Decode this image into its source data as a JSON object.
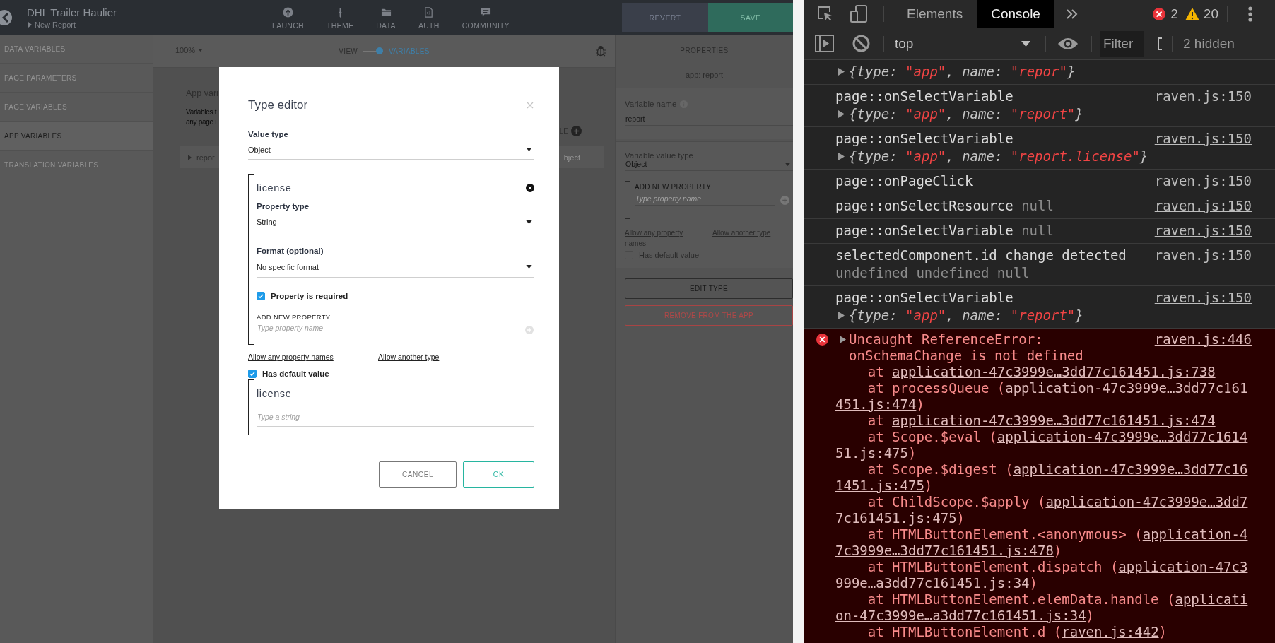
{
  "app": {
    "header": {
      "title": "DHL Trailer Haulier",
      "subtitle": "New Report",
      "nav": [
        "LAUNCH",
        "THEME",
        "DATA",
        "AUTH",
        "COMMUNITY"
      ],
      "buttons": [
        {
          "label": "REVERT",
          "kind": "revert"
        },
        {
          "label": "SAVE",
          "kind": "save"
        }
      ]
    },
    "sidebar": {
      "items": [
        {
          "label": "DATA VARIABLES",
          "selected": false
        },
        {
          "label": "PAGE PARAMETERS",
          "selected": false
        },
        {
          "label": "PAGE VARIABLES",
          "selected": false
        },
        {
          "label": "APP VARIABLES",
          "selected": true
        },
        {
          "label": "TRANSLATION VARIABLES",
          "selected": false
        }
      ]
    },
    "toolbar": {
      "zoom": "100%",
      "view_toggle": {
        "left_label": "VIEW",
        "right_label": "VARIABLES",
        "on": true
      }
    },
    "content": {
      "heading": "App vari",
      "description": [
        "Variables t",
        "any page i"
      ],
      "add_label": "LE",
      "row": {
        "name": "repor",
        "type": "bject"
      }
    },
    "properties": {
      "title": "PROPERTIES",
      "subtitle": "app: report",
      "name_field": {
        "label": "Variable name",
        "value": "report"
      },
      "type_field": {
        "label": "Variable value type",
        "value": "Object"
      },
      "add_property": {
        "label": "ADD NEW PROPERTY",
        "placeholder": "Type property name"
      },
      "links": [
        "Allow any property names",
        "Allow another type"
      ],
      "has_default": {
        "label": "Has default value",
        "checked": false
      },
      "buttons": [
        {
          "label": "EDIT TYPE",
          "kind": "neutral"
        },
        {
          "label": "REMOVE FROM THE APP",
          "kind": "danger"
        }
      ]
    },
    "modal": {
      "title": "Type editor",
      "value_type": {
        "label": "Value type",
        "value": "Object"
      },
      "property": {
        "name": "license",
        "type": {
          "label": "Property type",
          "value": "String"
        },
        "format": {
          "label": "Format (optional)",
          "value": "No specific format"
        },
        "required": {
          "label": "Property is required",
          "checked": true
        }
      },
      "add_property": {
        "label": "ADD NEW PROPERTY",
        "placeholder": "Type property name"
      },
      "links": [
        "Allow any property names",
        "Allow another type"
      ],
      "has_default": {
        "label": "Has default value",
        "checked": true
      },
      "default_value": {
        "name": "license",
        "placeholder": "Type a string"
      },
      "buttons": [
        {
          "label": "CANCEL",
          "kind": "secondary"
        },
        {
          "label": "OK",
          "kind": "primary"
        }
      ]
    }
  },
  "devtools": {
    "tabs": [
      {
        "label": "Elements",
        "selected": false
      },
      {
        "label": "Console",
        "selected": true
      }
    ],
    "error_count": "2",
    "warning_count": "20",
    "context": "top",
    "filter_placeholder": "Filter",
    "hidden_count": "2 hidden",
    "messages": [
      {
        "kind": "object",
        "object": [
          {
            "t": "{type: ",
            "kind": "plain"
          },
          {
            "t": "\"app\"",
            "kind": "string"
          },
          {
            "t": ", name: ",
            "kind": "plain"
          },
          {
            "t": "\"repor\"",
            "kind": "string"
          },
          {
            "t": "}",
            "kind": "plain"
          }
        ]
      },
      {
        "kind": "log",
        "text": "page::onSelectVariable",
        "source": "raven.js:150",
        "object": [
          {
            "t": "{type: ",
            "kind": "plain"
          },
          {
            "t": "\"app\"",
            "kind": "string"
          },
          {
            "t": ", name: ",
            "kind": "plain"
          },
          {
            "t": "\"report\"",
            "kind": "string"
          },
          {
            "t": "}",
            "kind": "plain"
          }
        ]
      },
      {
        "kind": "log",
        "text": "page::onSelectVariable",
        "source": "raven.js:150",
        "object": [
          {
            "t": "{type: ",
            "kind": "plain"
          },
          {
            "t": "\"app\"",
            "kind": "string"
          },
          {
            "t": ", name: ",
            "kind": "plain"
          },
          {
            "t": "\"report.license\"",
            "kind": "string"
          },
          {
            "t": "}",
            "kind": "plain"
          }
        ]
      },
      {
        "kind": "log",
        "text": "page::onPageClick",
        "source": "raven.js:150"
      },
      {
        "kind": "log",
        "text": "page::onSelectResource",
        "arg": "null",
        "source": "raven.js:150"
      },
      {
        "kind": "log",
        "text": "page::onSelectVariable",
        "arg": "null",
        "source": "raven.js:150"
      },
      {
        "kind": "log",
        "text": "selectedComponent.id change detected",
        "arg": "undefined undefined null",
        "source": "raven.js:150"
      },
      {
        "kind": "log",
        "text": "page::onSelectVariable",
        "source": "raven.js:150",
        "object": [
          {
            "t": "{type: ",
            "kind": "plain"
          },
          {
            "t": "\"app\"",
            "kind": "string"
          },
          {
            "t": ", name: ",
            "kind": "plain"
          },
          {
            "t": "\"report\"",
            "kind": "string"
          },
          {
            "t": "}",
            "kind": "plain"
          }
        ]
      },
      {
        "kind": "error",
        "text": "Uncaught ReferenceError: onSchemaChange is not defined",
        "source": "raven.js:446",
        "stack": [
          {
            "text": "at ",
            "links": [
              "application-47c3999e…3dd77c161451.js:738"
            ]
          },
          {
            "text": "at processQueue (",
            "links": [
              "application-47c3999e…3dd77c161",
              "451.js:474"
            ],
            "tail": ")"
          },
          {
            "text": "at ",
            "links": [
              "application-47c3999e…3dd77c161451.js:474"
            ]
          },
          {
            "text": "at Scope.$eval (",
            "links": [
              "application-47c3999e…3dd77c1614",
              "51.js:475"
            ],
            "tail": ")"
          },
          {
            "text": "at Scope.$digest (",
            "links": [
              "application-47c3999e…3dd77c16",
              "1451.js:475"
            ],
            "tail": ")"
          },
          {
            "text": "at ChildScope.$apply (",
            "links": [
              "application-47c3999e…3dd7",
              "7c161451.js:475"
            ],
            "tail": ")"
          },
          {
            "text": "at HTMLButtonElement.<anonymous> (",
            "links": [
              "application-4",
              "7c3999e…3dd77c161451.js:478"
            ],
            "tail": ")"
          },
          {
            "text": "at HTMLButtonElement.dispatch (",
            "links": [
              "application-47c3",
              "999e…a3dd77c161451.js:34"
            ],
            "tail": ")"
          },
          {
            "text": "at HTMLButtonElement.elemData.handle (",
            "links": [
              "applicati",
              "on-47c3999e…a3dd77c161451.js:34"
            ],
            "tail": ")"
          },
          {
            "text": "at HTMLButtonElement.d (",
            "links": [
              "raven.js:442"
            ],
            "tail": ")"
          }
        ]
      }
    ]
  }
}
